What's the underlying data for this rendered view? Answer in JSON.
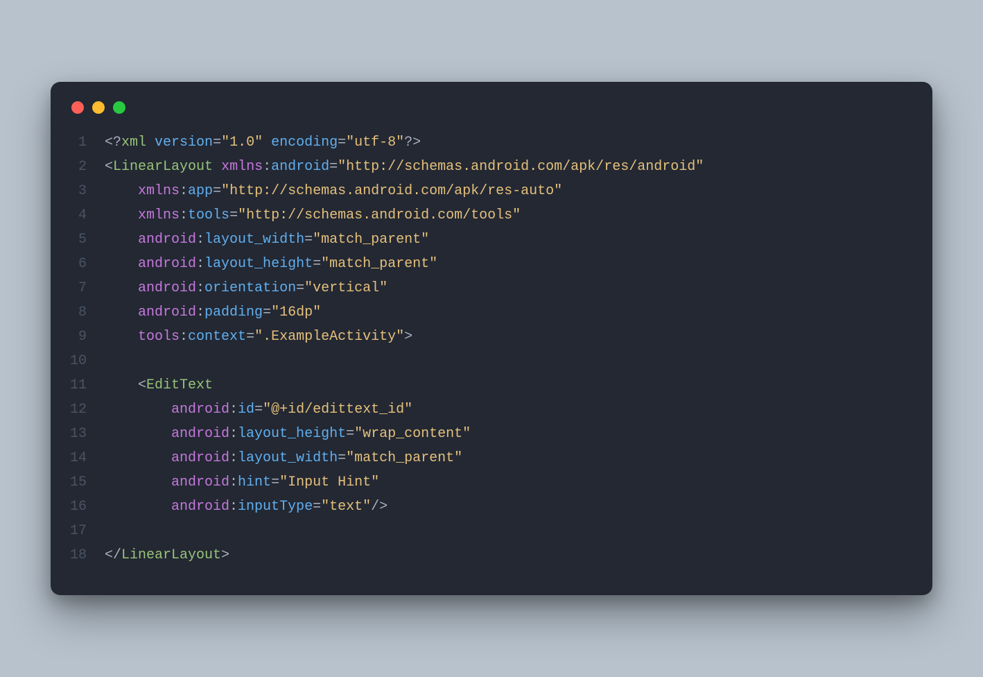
{
  "lineNumbers": [
    "1",
    "2",
    "3",
    "4",
    "5",
    "6",
    "7",
    "8",
    "9",
    "10",
    "11",
    "12",
    "13",
    "14",
    "15",
    "16",
    "17",
    "18"
  ],
  "code": {
    "l1": {
      "xml": "xml",
      "version": "version",
      "versionVal": "\"1.0\"",
      "encoding": "encoding",
      "encodingVal": "\"utf-8\""
    },
    "l2": {
      "tag": "LinearLayout",
      "ns": "xmlns",
      "attr": "android",
      "val": "\"http://schemas.android.com/apk/res/android\""
    },
    "l3": {
      "ns": "xmlns",
      "attr": "app",
      "val": "\"http://schemas.android.com/apk/res-auto\""
    },
    "l4": {
      "ns": "xmlns",
      "attr": "tools",
      "val": "\"http://schemas.android.com/tools\""
    },
    "l5": {
      "ns": "android",
      "attr": "layout_width",
      "val": "\"match_parent\""
    },
    "l6": {
      "ns": "android",
      "attr": "layout_height",
      "val": "\"match_parent\""
    },
    "l7": {
      "ns": "android",
      "attr": "orientation",
      "val": "\"vertical\""
    },
    "l8": {
      "ns": "android",
      "attr": "padding",
      "val": "\"16dp\""
    },
    "l9": {
      "ns": "tools",
      "attr": "context",
      "val": "\".ExampleActivity\""
    },
    "l11": {
      "tag": "EditText"
    },
    "l12": {
      "ns": "android",
      "attr": "id",
      "val": "\"@+id/edittext_id\""
    },
    "l13": {
      "ns": "android",
      "attr": "layout_height",
      "val": "\"wrap_content\""
    },
    "l14": {
      "ns": "android",
      "attr": "layout_width",
      "val": "\"match_parent\""
    },
    "l15": {
      "ns": "android",
      "attr": "hint",
      "val": "\"Input Hint\""
    },
    "l16": {
      "ns": "android",
      "attr": "inputType",
      "val": "\"text\""
    },
    "l18": {
      "tag": "LinearLayout"
    }
  }
}
